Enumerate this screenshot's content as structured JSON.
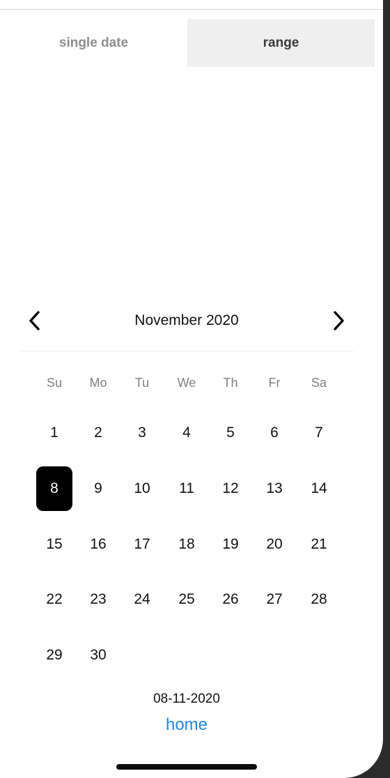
{
  "tabs": {
    "single_label": "single date",
    "range_label": "range"
  },
  "calendar": {
    "month_title": "November 2020",
    "weekdays": [
      "Su",
      "Mo",
      "Tu",
      "We",
      "Th",
      "Fr",
      "Sa"
    ],
    "days": [
      "1",
      "2",
      "3",
      "4",
      "5",
      "6",
      "7",
      "8",
      "9",
      "10",
      "11",
      "12",
      "13",
      "14",
      "15",
      "16",
      "17",
      "18",
      "19",
      "20",
      "21",
      "22",
      "23",
      "24",
      "25",
      "26",
      "27",
      "28",
      "29",
      "30"
    ],
    "selected_day": "8"
  },
  "footer": {
    "selected_date": "08-11-2020",
    "home_link": "home"
  },
  "icons": {
    "prev": "chevron-left-icon",
    "next": "chevron-right-icon"
  },
  "colors": {
    "selected_bg": "#000000",
    "link": "#1e88e5",
    "active_tab_bg": "#efefef"
  }
}
